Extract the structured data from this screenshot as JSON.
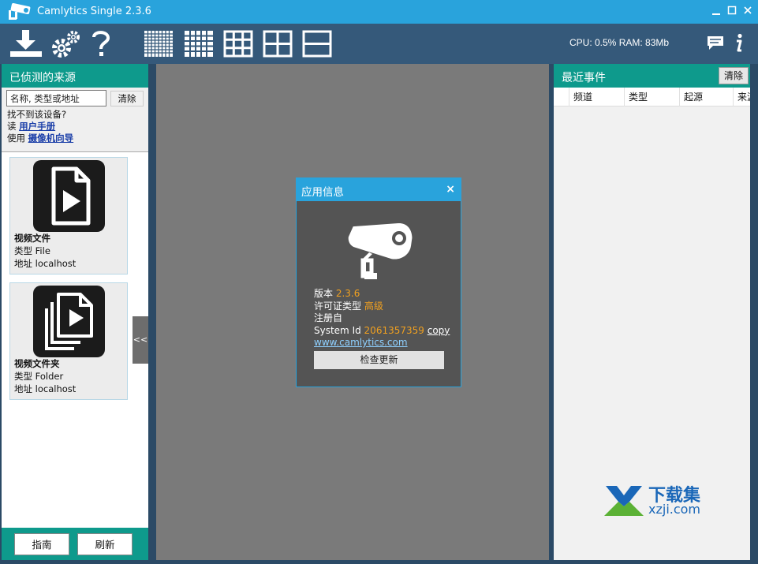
{
  "window": {
    "title": "Camlytics Single 2.3.6",
    "controls": [
      "minimize-icon",
      "maximize-icon",
      "close-icon"
    ]
  },
  "toolbar": {
    "icons": [
      "download-icon",
      "settings-icon",
      "help-icon",
      "grid-8x8-icon",
      "grid-5x5-icon",
      "grid-3x3-icon",
      "grid-2x2-icon",
      "split-horizontal-icon"
    ],
    "status": "CPU: 0.5% RAM: 83Mb",
    "right_icons": [
      "chat-icon",
      "info-icon"
    ]
  },
  "sources": {
    "title": "已侦测的来源",
    "search_placeholder": "名称, 类型或地址",
    "clear_label": "清除",
    "help_line1": "找不到该设备?",
    "help_read": "读 ",
    "help_manual": "用户手册",
    "help_use": "使用 ",
    "help_wizard": "摄像机向导",
    "items": [
      {
        "name": "视频文件",
        "type": "类型  File",
        "address": "地址  localhost",
        "icon": "video-file-icon"
      },
      {
        "name": "视频文件夹",
        "type": "类型  Folder",
        "address": "地址  localhost",
        "icon": "video-folder-icon"
      }
    ],
    "guide_label": "指南",
    "refresh_label": "刷新",
    "collapse_label": "<<"
  },
  "dialog": {
    "title": "应用信息",
    "close": "×",
    "version_label": "版本 ",
    "version": "2.3.6",
    "license_label": "许可证类型  ",
    "license": "高级",
    "registered_label": "注册自",
    "system_id_label": "System Id  ",
    "system_id": "2061357359",
    "copy_label": "copy",
    "website": "www.camlytics.com",
    "check_update_label": "检查更新",
    "icon": "security-camera-icon"
  },
  "events": {
    "title": "最近事件",
    "clear_label": "清除",
    "columns": [
      "频道",
      "类型",
      "起源",
      "来源"
    ]
  },
  "watermark": {
    "line1": "下载集",
    "line2": "xzji.com"
  }
}
